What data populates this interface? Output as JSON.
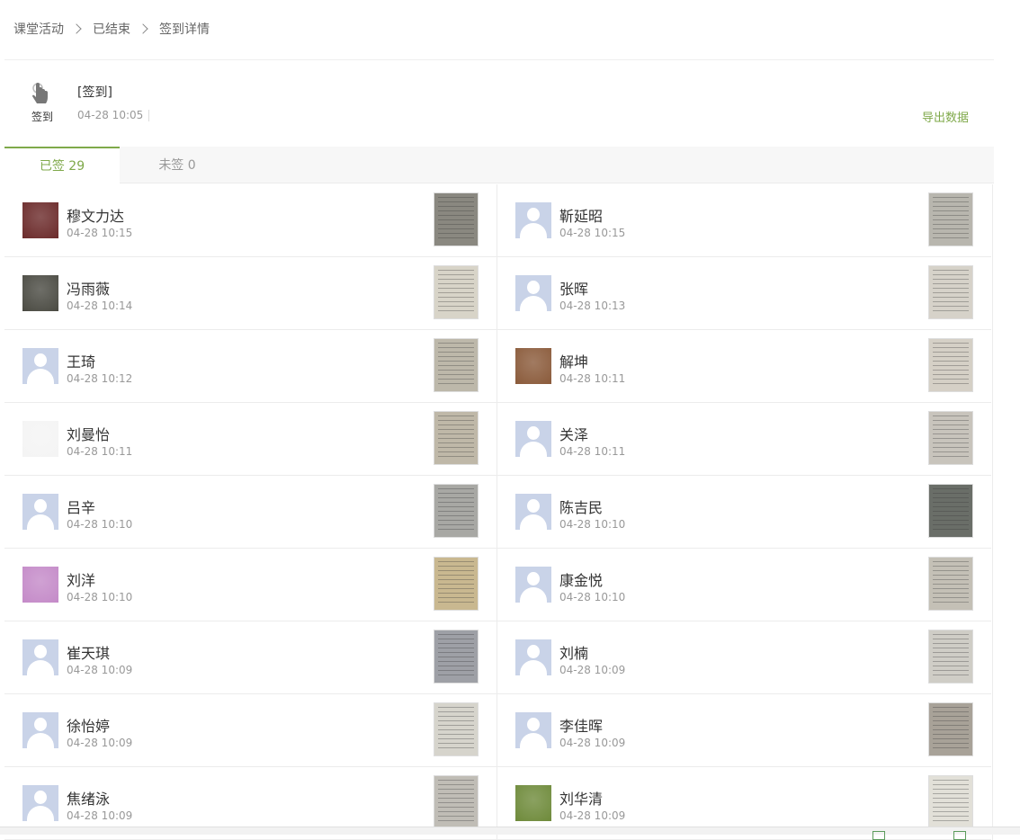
{
  "breadcrumb": [
    "课堂活动",
    "已结束",
    "签到详情"
  ],
  "activity": {
    "icon": "hand-pointer-icon",
    "type_label": "签到",
    "title": "[签到]",
    "time": "04-28 10:05",
    "export_label": "导出数据"
  },
  "tabs": {
    "signed": "已签 29",
    "unsigned": "未签 0"
  },
  "accent": "#7fa94a",
  "students": [
    {
      "name": "穆文力达",
      "time": "04-28 10:15",
      "avatar": "photo",
      "avatar_color": "#6b2a2a",
      "photo_color": "#8a8880"
    },
    {
      "name": "靳延昭",
      "time": "04-28 10:15",
      "avatar": "default",
      "photo_color": "#b8b6ae"
    },
    {
      "name": "冯雨薇",
      "time": "04-28 10:14",
      "avatar": "photo",
      "avatar_color": "#4a4a42",
      "photo_color": "#d8d4c8"
    },
    {
      "name": "张晖",
      "time": "04-28 10:13",
      "avatar": "default",
      "photo_color": "#d6d2c9"
    },
    {
      "name": "王琦",
      "time": "04-28 10:12",
      "avatar": "default",
      "photo_color": "#bdb8aa"
    },
    {
      "name": "解坤",
      "time": "04-28 10:11",
      "avatar": "photo",
      "avatar_color": "#8a5a3a",
      "photo_color": "#d5d0c6"
    },
    {
      "name": "刘曼怡",
      "time": "04-28 10:11",
      "avatar": "sketch",
      "avatar_color": "#f4f4f4",
      "photo_color": "#bfb8a8"
    },
    {
      "name": "关泽",
      "time": "04-28 10:11",
      "avatar": "default",
      "photo_color": "#c8c4bc"
    },
    {
      "name": "吕辛",
      "time": "04-28 10:10",
      "avatar": "default",
      "photo_color": "#a8a8a4"
    },
    {
      "name": "陈吉民",
      "time": "04-28 10:10",
      "avatar": "default",
      "photo_color": "#6a6e68"
    },
    {
      "name": "刘洋",
      "time": "04-28 10:10",
      "avatar": "photo",
      "avatar_color": "#c48ac8",
      "photo_color": "#c9b890"
    },
    {
      "name": "康金悦",
      "time": "04-28 10:10",
      "avatar": "default",
      "photo_color": "#c4c0b6"
    },
    {
      "name": "崔天琪",
      "time": "04-28 10:09",
      "avatar": "default",
      "photo_color": "#9ea0a6"
    },
    {
      "name": "刘楠",
      "time": "04-28 10:09",
      "avatar": "default",
      "photo_color": "#cfcdc6"
    },
    {
      "name": "徐怡婷",
      "time": "04-28 10:09",
      "avatar": "default",
      "photo_color": "#d6d4cc"
    },
    {
      "name": "李佳晖",
      "time": "04-28 10:09",
      "avatar": "default",
      "photo_color": "#a8a298"
    },
    {
      "name": "焦绪泳",
      "time": "04-28 10:09",
      "avatar": "default",
      "photo_color": "#c0bdb6"
    },
    {
      "name": "刘华清",
      "time": "04-28 10:09",
      "avatar": "photo",
      "avatar_color": "#6e8a3a",
      "photo_color": "#e2e0d8"
    }
  ]
}
